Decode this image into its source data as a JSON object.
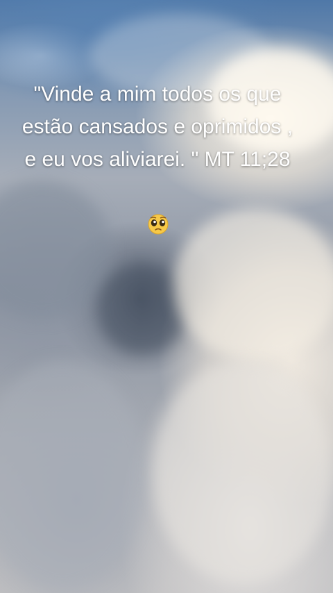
{
  "story": {
    "background": "cloudy-sky-photo",
    "caption_text": "\"Vinde a mim todos os que estão cansados e oprimidos , e eu vos aliviarei. \" MT 11;28",
    "emoji": "pleading-face-emoji"
  }
}
